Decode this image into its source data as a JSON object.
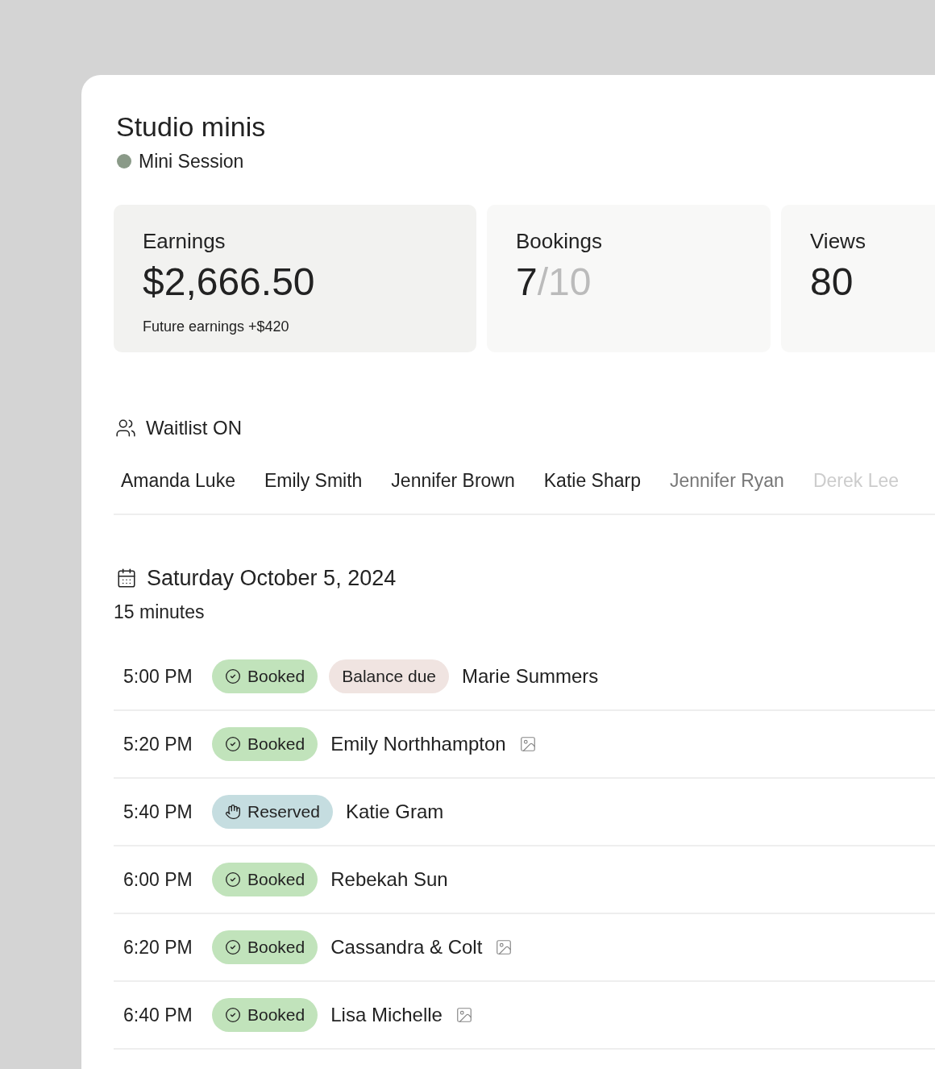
{
  "header": {
    "title": "Studio minis",
    "type_label": "Mini Session"
  },
  "stats": [
    {
      "label": "Earnings",
      "value": "$2,666.50",
      "note": "Future earnings +$420"
    },
    {
      "label": "Bookings",
      "value": "7",
      "total": "/10"
    },
    {
      "label": "Views",
      "value": "80"
    }
  ],
  "waitlist": {
    "title": "Waitlist ON",
    "names": [
      "Amanda Luke",
      "Emily Smith",
      "Jennifer Brown",
      "Katie Sharp",
      "Jennifer Ryan",
      "Derek Lee"
    ]
  },
  "schedule": {
    "date": "Saturday October 5, 2024",
    "duration": "15 minutes",
    "rows": [
      {
        "time": "5:00 PM",
        "badges": [
          {
            "kind": "booked",
            "label": "Booked"
          },
          {
            "kind": "balance_due",
            "label": "Balance due"
          }
        ],
        "name": "Marie Summers",
        "has_photo": false
      },
      {
        "time": "5:20 PM",
        "badges": [
          {
            "kind": "booked",
            "label": "Booked"
          }
        ],
        "name": "Emily Northhampton",
        "has_photo": true
      },
      {
        "time": "5:40 PM",
        "badges": [
          {
            "kind": "reserved",
            "label": "Reserved"
          }
        ],
        "name": "Katie Gram",
        "has_photo": false
      },
      {
        "time": "6:00 PM",
        "badges": [
          {
            "kind": "booked",
            "label": "Booked"
          }
        ],
        "name": "Rebekah Sun",
        "has_photo": false
      },
      {
        "time": "6:20 PM",
        "badges": [
          {
            "kind": "booked",
            "label": "Booked"
          }
        ],
        "name": "Cassandra & Colt",
        "has_photo": true
      },
      {
        "time": "6:40 PM",
        "badges": [
          {
            "kind": "booked",
            "label": "Booked"
          }
        ],
        "name": "Lisa Michelle",
        "has_photo": true
      }
    ]
  }
}
